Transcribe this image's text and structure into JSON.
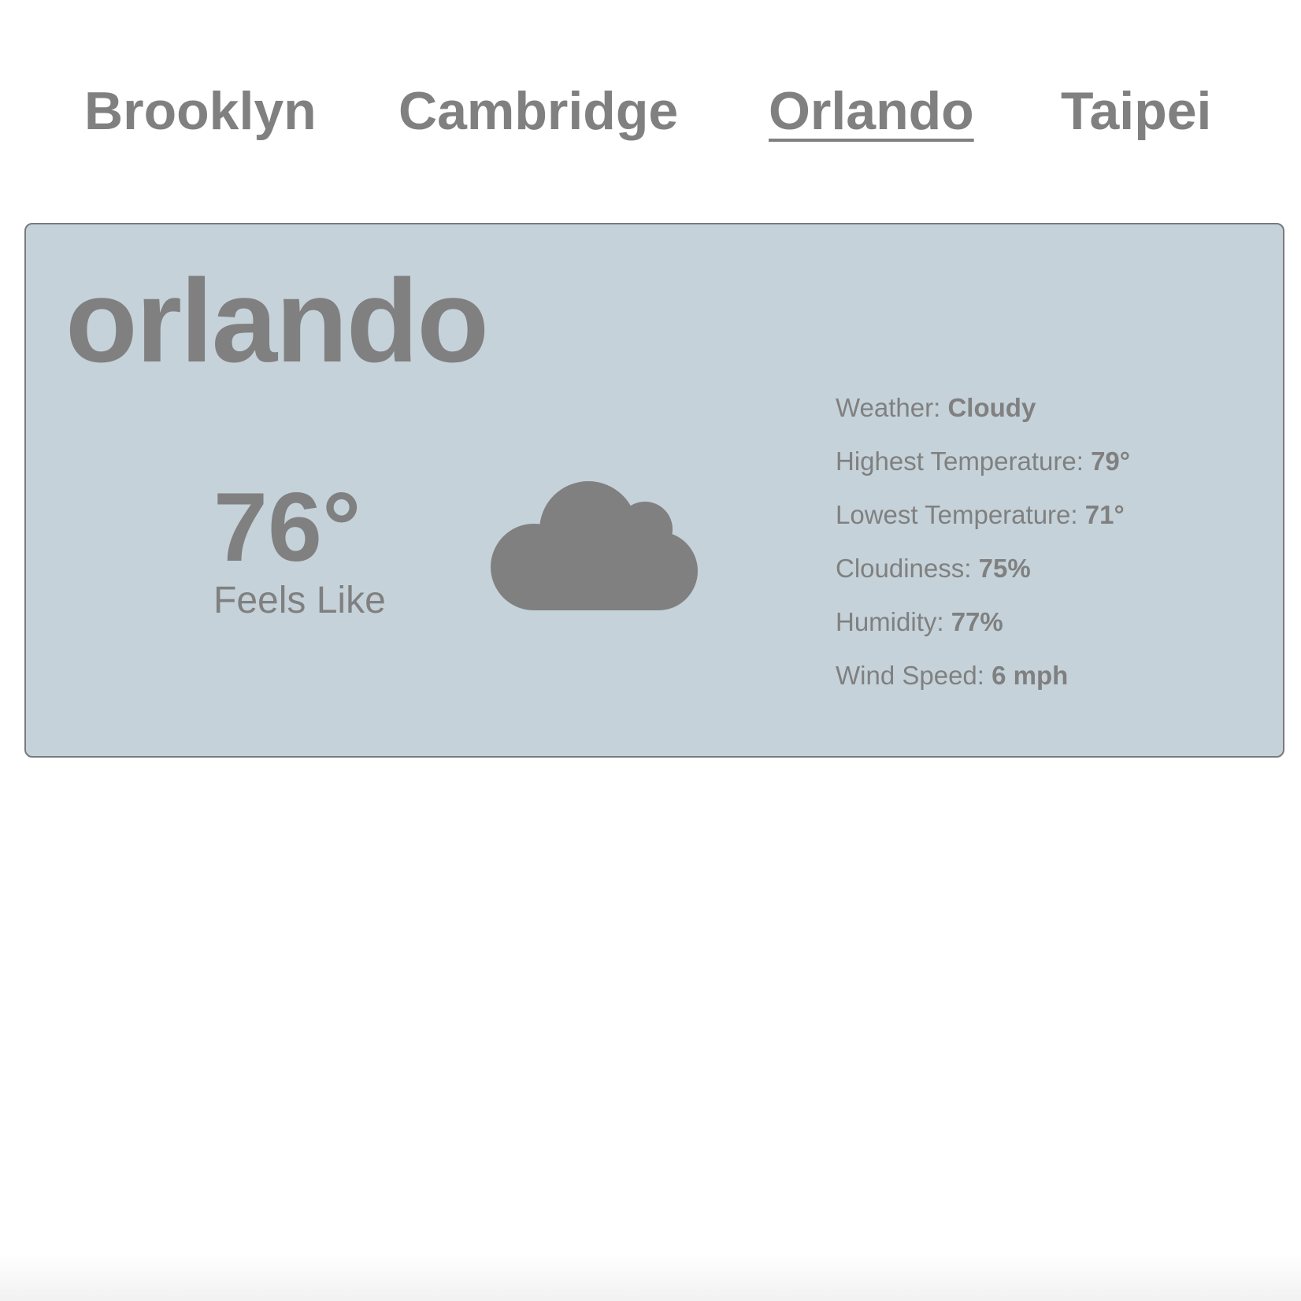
{
  "nav": {
    "tabs": [
      {
        "label": "Brooklyn"
      },
      {
        "label": "Cambridge"
      },
      {
        "label": "Orlando",
        "active": true
      },
      {
        "label": "Taipei"
      }
    ]
  },
  "card": {
    "city": "orlando",
    "temperature": "76°",
    "feels_like_label": "Feels Like",
    "icon": "cloud-icon",
    "details": [
      {
        "label": "Weather: ",
        "value": "Cloudy"
      },
      {
        "label": "Highest Temperature: ",
        "value": "79°"
      },
      {
        "label": "Lowest Temperature: ",
        "value": "71°"
      },
      {
        "label": "Cloudiness: ",
        "value": "75%"
      },
      {
        "label": "Humidity: ",
        "value": "77%"
      },
      {
        "label": "Wind Speed: ",
        "value": "6 mph"
      }
    ]
  },
  "colors": {
    "text": "#808080",
    "card_background": "#c5d2d9",
    "card_border": "#7a7a7a"
  }
}
